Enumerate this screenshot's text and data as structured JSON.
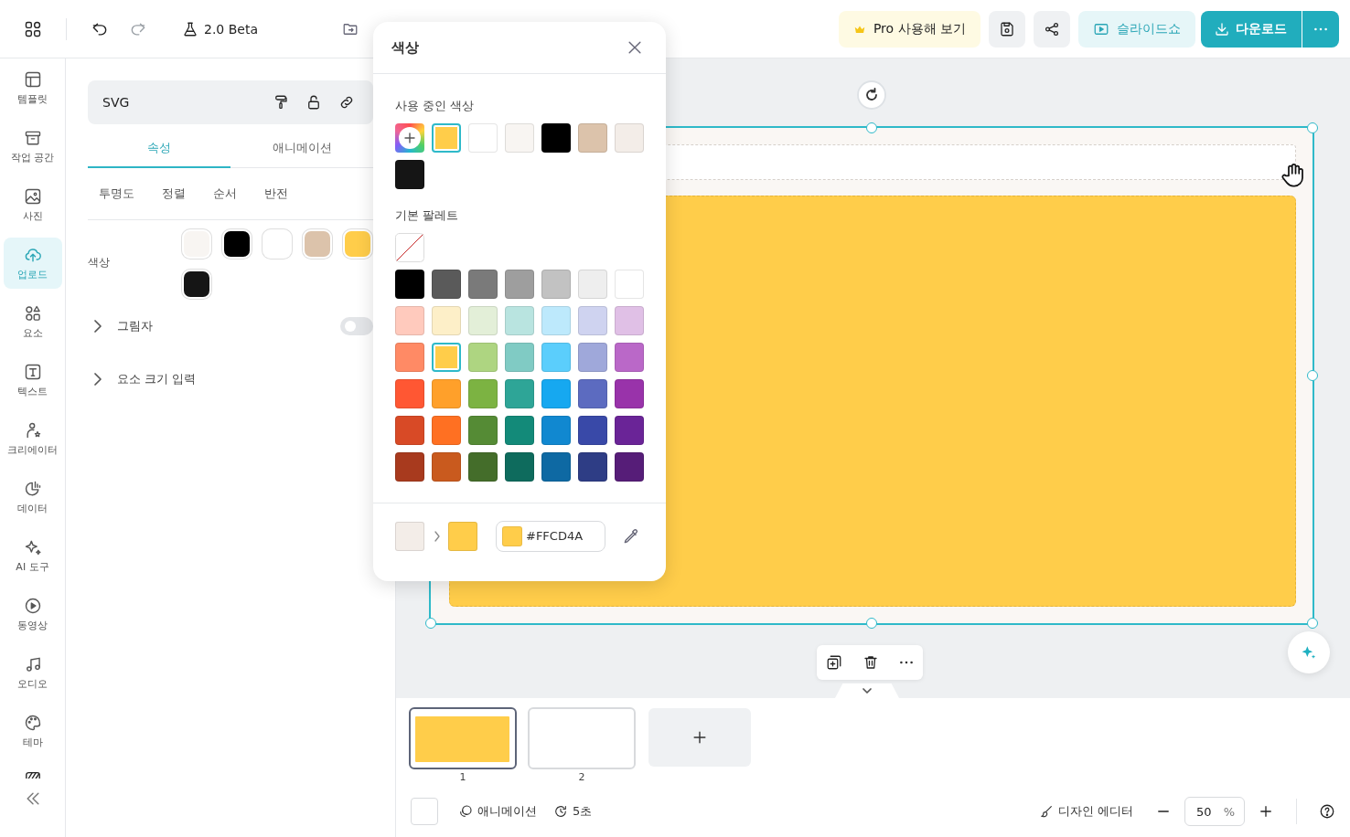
{
  "topbar": {
    "version": "2.0 Beta",
    "pro_button": "Pro 사용해 보기",
    "slideshow_button": "슬라이드쇼",
    "download_button": "다운로드"
  },
  "sidebar": {
    "items": [
      {
        "label": "템플릿",
        "selected": false
      },
      {
        "label": "작업 공간",
        "selected": false
      },
      {
        "label": "사진",
        "selected": false
      },
      {
        "label": "업로드",
        "selected": true
      },
      {
        "label": "요소",
        "selected": false
      },
      {
        "label": "텍스트",
        "selected": false
      },
      {
        "label": "크리에이터",
        "selected": false
      },
      {
        "label": "데이터",
        "selected": false
      },
      {
        "label": "AI 도구",
        "selected": false
      },
      {
        "label": "동영상",
        "selected": false
      },
      {
        "label": "오디오",
        "selected": false
      },
      {
        "label": "테마",
        "selected": false
      }
    ]
  },
  "panel": {
    "element_type": "SVG",
    "tabs": [
      {
        "label": "속성",
        "selected": true
      },
      {
        "label": "애니메이션",
        "selected": false
      }
    ],
    "subtabs": [
      "투명도",
      "정렬",
      "순서",
      "반전"
    ],
    "color_label": "색상",
    "colors": [
      {
        "color": "#f8f5f2"
      },
      {
        "color": "#000000"
      },
      {
        "color": "#ffffff"
      },
      {
        "color": "#dcc3ab"
      },
      {
        "color": "#ffcd4a"
      },
      {
        "color": "#151515"
      }
    ],
    "shadow": {
      "label": "그림자",
      "on": false
    },
    "size_input": {
      "label": "요소 크기 입력"
    }
  },
  "color_popup": {
    "title": "색상",
    "in_use_label": "사용 중인 색상",
    "in_use": [
      {
        "color": "#ffcd4a",
        "selected": true
      },
      {
        "color": "#ffffff",
        "selected": false
      },
      {
        "color": "#f8f5f2",
        "selected": false
      },
      {
        "color": "#000000",
        "selected": false
      },
      {
        "color": "#dcc3ab",
        "selected": false
      },
      {
        "color": "#f3ede8",
        "selected": false
      },
      {
        "color": "#151515",
        "selected": false
      }
    ],
    "palette_label": "기본 팔레트",
    "palette": [
      {
        "color": "#000000",
        "selected": false
      },
      {
        "color": "#5a5a5a",
        "selected": false
      },
      {
        "color": "#7a7a7a",
        "selected": false
      },
      {
        "color": "#9e9e9e",
        "selected": false
      },
      {
        "color": "#c2c2c2",
        "selected": false
      },
      {
        "color": "#eeeeee",
        "selected": false
      },
      {
        "color": "#ffffff",
        "selected": false
      },
      {
        "color": "#ffcabd",
        "selected": false
      },
      {
        "color": "#fdefc8",
        "selected": false
      },
      {
        "color": "#e3efd8",
        "selected": false
      },
      {
        "color": "#b9e4e0",
        "selected": false
      },
      {
        "color": "#bde9fc",
        "selected": false
      },
      {
        "color": "#cfd3f0",
        "selected": false
      },
      {
        "color": "#e0c0e6",
        "selected": false
      },
      {
        "color": "#ff8a65",
        "selected": false
      },
      {
        "color": "#ffcd4a",
        "selected": true
      },
      {
        "color": "#aed581",
        "selected": false
      },
      {
        "color": "#80cbc4",
        "selected": false
      },
      {
        "color": "#5bcefc",
        "selected": false
      },
      {
        "color": "#9fa8da",
        "selected": false
      },
      {
        "color": "#ba68c8",
        "selected": false
      },
      {
        "color": "#ff5733",
        "selected": false
      },
      {
        "color": "#ffa02a",
        "selected": false
      },
      {
        "color": "#7cb342",
        "selected": false
      },
      {
        "color": "#2ea597",
        "selected": false
      },
      {
        "color": "#16a8f0",
        "selected": false
      },
      {
        "color": "#5c6bc0",
        "selected": false
      },
      {
        "color": "#9933aa",
        "selected": false
      },
      {
        "color": "#d84a26",
        "selected": false
      },
      {
        "color": "#ff7022",
        "selected": false
      },
      {
        "color": "#558b35",
        "selected": false
      },
      {
        "color": "#138a79",
        "selected": false
      },
      {
        "color": "#1188d0",
        "selected": false
      },
      {
        "color": "#3949a8",
        "selected": false
      },
      {
        "color": "#6a2497",
        "selected": false
      },
      {
        "color": "#a83a1e",
        "selected": false
      },
      {
        "color": "#c95a1e",
        "selected": false
      },
      {
        "color": "#446d2a",
        "selected": false
      },
      {
        "color": "#0e6b5d",
        "selected": false
      },
      {
        "color": "#0e69a3",
        "selected": false
      },
      {
        "color": "#2e3d85",
        "selected": false
      },
      {
        "color": "#561d78",
        "selected": false
      }
    ],
    "comparison": [
      {
        "color": "#f3ede8"
      },
      {
        "color": "#ffcd4a"
      }
    ],
    "hex_value": "#FFCD4A"
  },
  "slides": [
    {
      "number": "1",
      "selected": true,
      "kind": "filled"
    },
    {
      "number": "2",
      "selected": false,
      "kind": "blank"
    }
  ],
  "bottom_bar": {
    "animation": "애니메이션",
    "duration": "5초",
    "design_editor": "디자인 에디터",
    "zoom": "50",
    "zoom_unit": "%"
  }
}
